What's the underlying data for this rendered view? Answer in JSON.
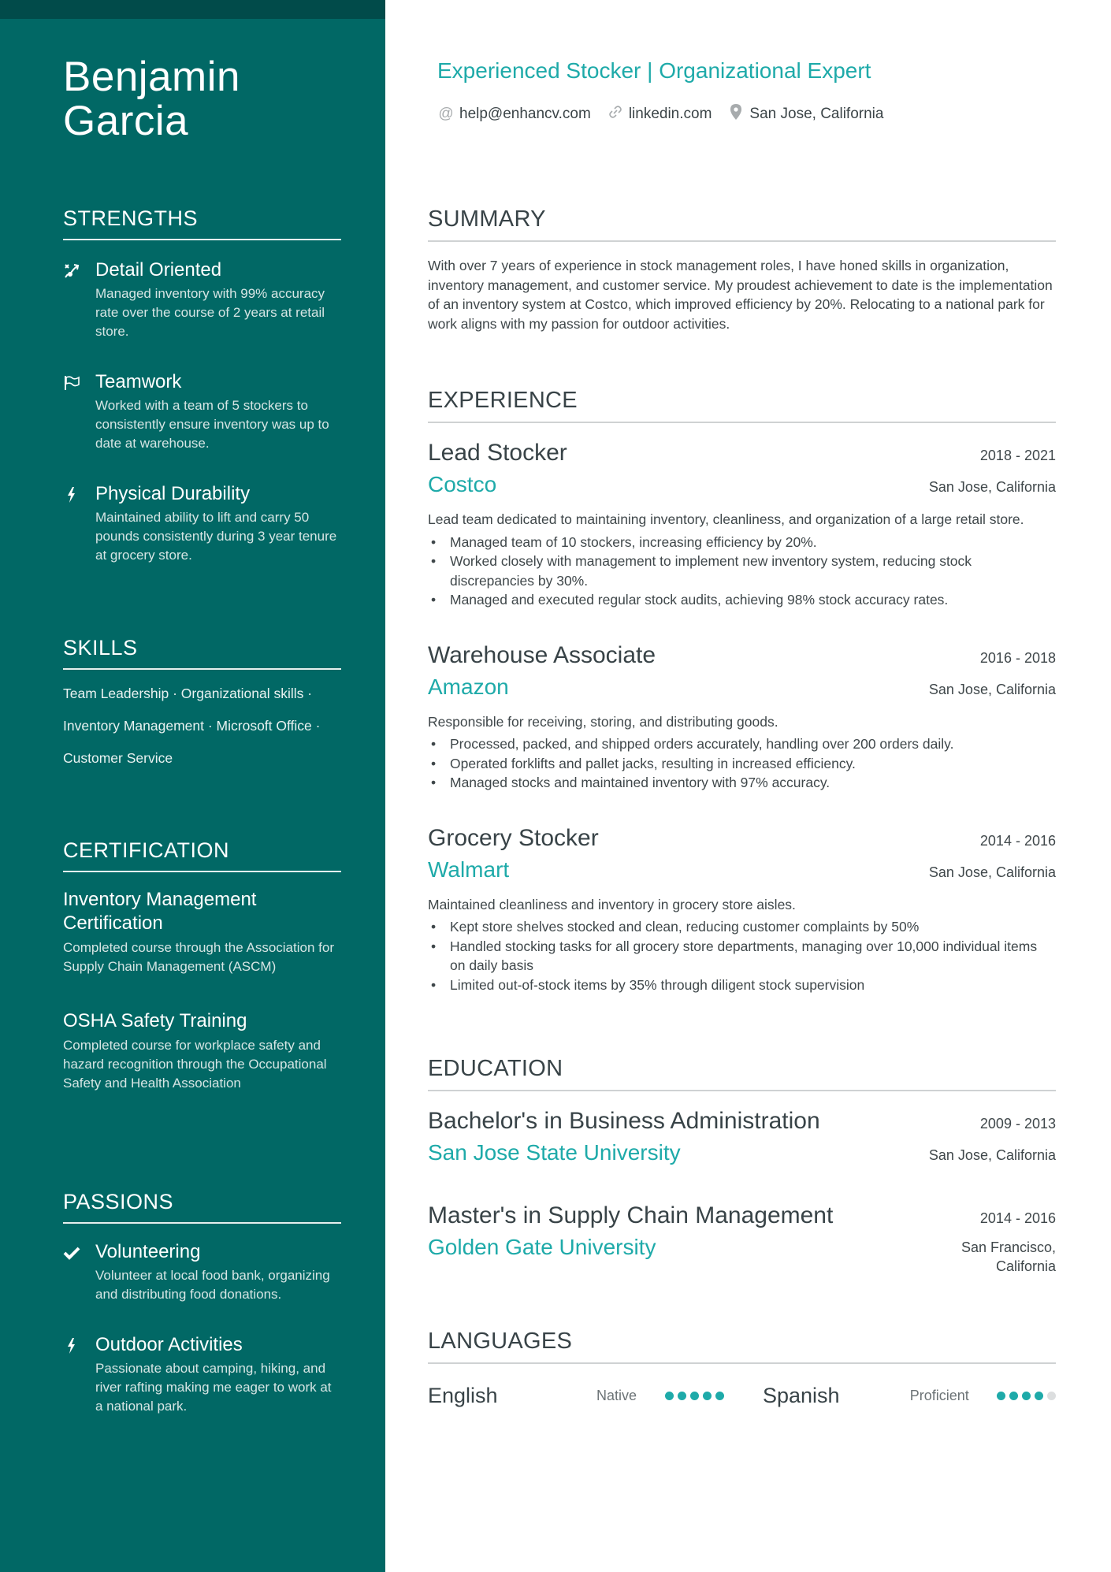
{
  "colors": {
    "sidebar": "#016865",
    "sidebar_band": "#014b4a",
    "accent": "#1eaaa9",
    "text": "#384347"
  },
  "name": "Benjamin Garcia",
  "name_lines": [
    "Benjamin",
    "Garcia"
  ],
  "headline": "Experienced Stocker | Organizational Expert",
  "contacts": [
    {
      "icon": "at-icon",
      "text": "help@enhancv.com"
    },
    {
      "icon": "link-icon",
      "text": "linkedin.com"
    },
    {
      "icon": "location-pin-icon",
      "text": "San Jose, California"
    }
  ],
  "sidebar": {
    "strengths": {
      "heading": "STRENGTHS",
      "items": [
        {
          "icon": "route-icon",
          "title": "Detail Oriented",
          "desc": "Managed inventory with 99% accuracy rate over the course of 2 years at retail store."
        },
        {
          "icon": "flag-icon",
          "title": "Teamwork",
          "desc": "Worked with a team of 5 stockers to consistently ensure inventory was up to date at warehouse."
        },
        {
          "icon": "lightning-icon",
          "title": "Physical Durability",
          "desc": "Maintained ability to lift and carry 50 pounds consistently during 3 year tenure at grocery store."
        }
      ]
    },
    "skills": {
      "heading": "SKILLS",
      "lines": [
        "Team Leadership · Organizational skills ·",
        "Inventory Management · Microsoft Office ·",
        "Customer Service"
      ]
    },
    "certification": {
      "heading": "CERTIFICATION",
      "items": [
        {
          "title": "Inventory Management Certification",
          "desc": "Completed course through the Association for Supply Chain Management (ASCM)"
        },
        {
          "title": "OSHA Safety Training",
          "desc": "Completed course for workplace safety and hazard recognition through the Occupational Safety and Health Association"
        }
      ]
    },
    "passions": {
      "heading": "PASSIONS",
      "items": [
        {
          "icon": "check-icon",
          "title": "Volunteering",
          "desc": "Volunteer at local food bank, organizing and distributing food donations."
        },
        {
          "icon": "lightning-icon",
          "title": "Outdoor Activities",
          "desc": "Passionate about camping, hiking, and river rafting making me eager to work at a national park."
        }
      ]
    }
  },
  "summary": {
    "heading": "SUMMARY",
    "text": "With over 7 years of experience in stock management roles, I have honed skills in organization, inventory management, and customer service. My proudest achievement to date is the implementation of an inventory system at Costco, which improved efficiency by 20%. Relocating to a national park for work aligns with my passion for outdoor activities."
  },
  "experience": {
    "heading": "EXPERIENCE",
    "items": [
      {
        "role": "Lead Stocker",
        "dates": "2018 - 2021",
        "company": "Costco",
        "location": "San Jose, California",
        "desc": "Lead team dedicated to maintaining inventory, cleanliness, and organization of a large retail store.",
        "bullets": [
          "Managed team of 10 stockers, increasing efficiency by 20%.",
          "Worked closely with management to implement new inventory system, reducing stock discrepancies by 30%.",
          "Managed and executed regular stock audits, achieving 98% stock accuracy rates."
        ]
      },
      {
        "role": "Warehouse Associate",
        "dates": "2016 - 2018",
        "company": "Amazon",
        "location": "San Jose, California",
        "desc": "Responsible for receiving, storing, and distributing goods.",
        "bullets": [
          "Processed, packed, and shipped orders accurately, handling over 200 orders daily.",
          "Operated forklifts and pallet jacks, resulting in increased efficiency.",
          "Managed stocks and maintained inventory with 97% accuracy."
        ]
      },
      {
        "role": "Grocery Stocker",
        "dates": "2014 - 2016",
        "company": "Walmart",
        "location": "San Jose, California",
        "desc": "Maintained cleanliness and inventory in grocery store aisles.",
        "bullets": [
          "Kept store shelves stocked and clean, reducing customer complaints by 50%",
          "Handled stocking tasks for all grocery store departments, managing over 10,000 individual items on daily basis",
          "Limited out-of-stock items by 35% through diligent stock supervision"
        ]
      }
    ]
  },
  "education": {
    "heading": "EDUCATION",
    "items": [
      {
        "degree": "Bachelor's in Business Administration",
        "dates": "2009 - 2013",
        "school": "San Jose State University",
        "location": "San Jose, California"
      },
      {
        "degree": "Master's in Supply Chain Management",
        "dates": "2014 - 2016",
        "school": "Golden Gate University",
        "location": "San Francisco, California"
      }
    ]
  },
  "languages": {
    "heading": "LANGUAGES",
    "items": [
      {
        "name": "English",
        "level": "Native",
        "rating": 5,
        "max": 5
      },
      {
        "name": "Spanish",
        "level": "Proficient",
        "rating": 4,
        "max": 5
      }
    ]
  }
}
